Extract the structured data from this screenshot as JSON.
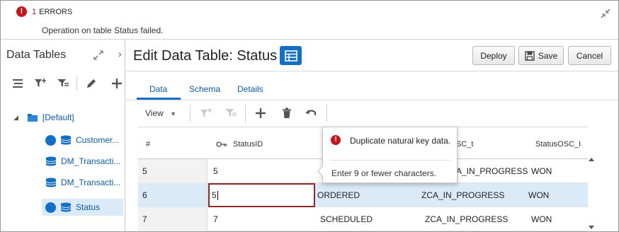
{
  "banner": {
    "count": "1",
    "title": "ERRORS",
    "message": "Operation on table Status failed."
  },
  "left_panel": {
    "title": "Data Tables",
    "tree": {
      "root": "[Default]",
      "items": [
        {
          "label": "Customer..."
        },
        {
          "label": "DM_Transacti..."
        },
        {
          "label": "DM_Transacti..."
        },
        {
          "label": "Status"
        }
      ]
    }
  },
  "header": {
    "title": "Edit Data Table: Status",
    "buttons": {
      "deploy": "Deploy",
      "save": "Save",
      "cancel": "Cancel"
    }
  },
  "tabs": [
    "Data",
    "Schema",
    "Details"
  ],
  "toolbar": {
    "view": "View"
  },
  "grid": {
    "columns": [
      "#",
      "StatusID",
      "SC_t",
      "StatusOSC_I"
    ],
    "rows": [
      {
        "num": "5",
        "id": "5",
        "col3": "E",
        "col4": "A_IN_PROGRESS",
        "col5": "WON"
      },
      {
        "num": "6",
        "id": "5",
        "col3": "ORDERED",
        "col4": "ZCA_IN_PROGRESS",
        "col5": "WON"
      },
      {
        "num": "7",
        "id": "7",
        "col3": "SCHEDULED",
        "col4": "ZCA_IN_PROGRESS",
        "col5": "WON"
      }
    ]
  },
  "popup": {
    "title": "Duplicate natural key data.",
    "message": "Enter 9 or fewer characters."
  },
  "colors": {
    "accent": "#1470c7",
    "error": "#c4161c",
    "selection": "#dbeaf7"
  }
}
